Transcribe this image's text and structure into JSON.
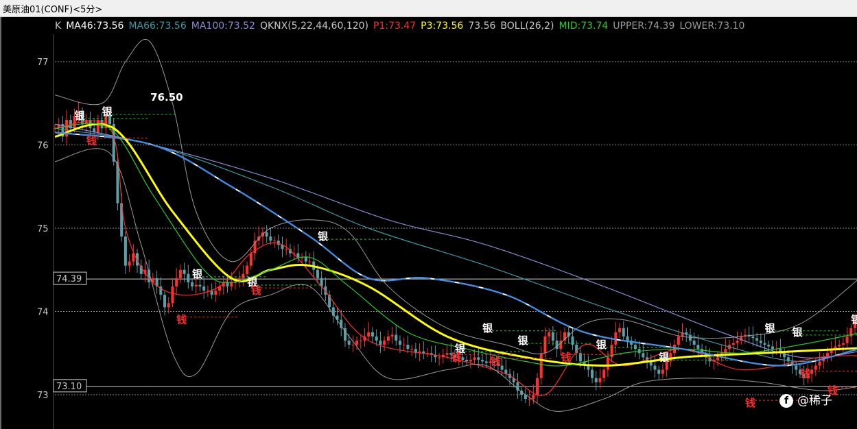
{
  "window": {
    "title": "美原油01(CONF)<5分>"
  },
  "legend": [
    {
      "text": "K",
      "color": "#c8c8c8"
    },
    {
      "text": "MA46:73.56",
      "color": "#ffffff"
    },
    {
      "text": "MA66:73.56",
      "color": "#3a9aa0"
    },
    {
      "text": "MA100:73.52",
      "color": "#8a8ad8"
    },
    {
      "text": "QKNX(5,22,44,60,120)",
      "color": "#c8c8c8"
    },
    {
      "text": "P1:73.47",
      "color": "#ff2a2a"
    },
    {
      "text": "P3:73.56",
      "color": "#ffff00"
    },
    {
      "text": "73.56",
      "color": "#c8c8c8"
    },
    {
      "text": "BOLL(26,2)",
      "color": "#c8c8c8"
    },
    {
      "text": "MID:73.74",
      "color": "#22cc22"
    },
    {
      "text": "UPPER:74.39",
      "color": "#9a9a9a"
    },
    {
      "text": "LOWER:73.10",
      "color": "#9a9a9a"
    }
  ],
  "watermark": {
    "text": "@稀子",
    "icon": "facebook-icon"
  },
  "chart_data": {
    "type": "line",
    "instrument": "美原油01(CONF)",
    "interval": "5分",
    "ylim": [
      72.6,
      77.4
    ],
    "y_ticks": [
      "77",
      "76",
      "75",
      "74",
      "73"
    ],
    "grid": true,
    "hlines": [
      {
        "label": "74.39",
        "value": 74.39
      },
      {
        "label": "73.10",
        "value": 73.1
      }
    ],
    "peak_label": {
      "text": "76.50",
      "x": 24,
      "y": 76.5
    },
    "x_count": 205,
    "price_close": [
      76.2,
      76.25,
      76.1,
      76.3,
      76.2,
      76.35,
      76.4,
      76.25,
      76.3,
      76.2,
      76.15,
      76.3,
      76.2,
      76.35,
      76.25,
      75.8,
      75.3,
      74.9,
      74.55,
      74.6,
      74.7,
      74.55,
      74.45,
      74.5,
      74.35,
      74.4,
      74.3,
      74.2,
      74.05,
      74.1,
      74.3,
      74.4,
      74.5,
      74.45,
      74.35,
      74.3,
      74.32,
      74.3,
      74.25,
      74.25,
      74.2,
      74.25,
      74.3,
      74.35,
      74.3,
      74.35,
      74.35,
      74.4,
      74.45,
      74.55,
      74.7,
      74.85,
      74.9,
      74.95,
      74.9,
      74.85,
      74.85,
      74.8,
      74.75,
      74.75,
      74.7,
      74.7,
      74.65,
      74.65,
      74.6,
      74.6,
      74.5,
      74.4,
      74.3,
      74.2,
      74.05,
      73.95,
      73.9,
      73.8,
      73.65,
      73.6,
      73.6,
      73.65,
      73.65,
      73.7,
      73.75,
      73.7,
      73.65,
      73.6,
      73.65,
      73.7,
      73.72,
      73.65,
      73.6,
      73.6,
      73.55,
      73.55,
      73.5,
      73.52,
      73.5,
      73.5,
      73.48,
      73.45,
      73.45,
      73.48,
      73.5,
      73.48,
      73.45,
      73.45,
      73.42,
      73.4,
      73.42,
      73.45,
      73.42,
      73.4,
      73.38,
      73.4,
      73.38,
      73.35,
      73.3,
      73.25,
      73.2,
      73.15,
      73.05,
      73.0,
      72.95,
      72.95,
      73.0,
      73.2,
      73.5,
      73.7,
      73.75,
      73.65,
      73.55,
      73.65,
      73.75,
      73.7,
      73.6,
      73.5,
      73.4,
      73.35,
      73.3,
      73.2,
      73.15,
      73.2,
      73.3,
      73.45,
      73.6,
      73.75,
      73.8,
      73.7,
      73.65,
      73.6,
      73.55,
      73.5,
      73.45,
      73.4,
      73.35,
      73.3,
      73.25,
      73.3,
      73.4,
      73.5,
      73.6,
      73.7,
      73.75,
      73.72,
      73.65,
      73.6,
      73.55,
      73.5,
      73.45,
      73.4,
      73.42,
      73.45,
      73.5,
      73.55,
      73.6,
      73.62,
      73.65,
      73.7,
      73.72,
      73.7,
      73.68,
      73.65,
      73.62,
      73.6,
      73.58,
      73.55,
      73.55,
      73.5,
      73.45,
      73.4,
      73.35,
      73.3,
      73.25,
      73.2,
      73.25,
      73.3,
      73.35,
      73.4,
      73.45,
      73.5,
      73.55,
      73.58,
      73.6,
      73.62,
      73.7,
      73.8,
      73.9
    ],
    "series": [
      {
        "name": "MA46",
        "color": "#ffffff",
        "points": [
          [
            0,
            76.15
          ],
          [
            25,
            76.0
          ],
          [
            45,
            75.5
          ],
          [
            65,
            74.9
          ],
          [
            80,
            74.4
          ],
          [
            95,
            74.4
          ],
          [
            115,
            74.2
          ],
          [
            135,
            73.75
          ],
          [
            160,
            73.55
          ],
          [
            185,
            73.35
          ],
          [
            205,
            73.55
          ]
        ]
      },
      {
        "name": "MA66",
        "color": "#3a9aa0",
        "points": [
          [
            0,
            76.2
          ],
          [
            25,
            76.0
          ],
          [
            55,
            75.5
          ],
          [
            80,
            75.0
          ],
          [
            110,
            74.55
          ],
          [
            140,
            74.05
          ],
          [
            170,
            73.6
          ],
          [
            190,
            73.4
          ],
          [
            205,
            73.55
          ]
        ]
      },
      {
        "name": "MA100",
        "color": "#8a8ad8",
        "points": [
          [
            0,
            76.25
          ],
          [
            25,
            76.0
          ],
          [
            55,
            75.6
          ],
          [
            85,
            75.1
          ],
          [
            110,
            74.8
          ],
          [
            140,
            74.3
          ],
          [
            170,
            73.75
          ],
          [
            190,
            73.45
          ],
          [
            205,
            73.52
          ]
        ]
      },
      {
        "name": "P1",
        "color": "#ff2a2a",
        "points": [
          [
            0,
            76.2
          ],
          [
            14,
            76.2
          ],
          [
            18,
            75.0
          ],
          [
            24,
            74.4
          ],
          [
            32,
            74.2
          ],
          [
            42,
            74.3
          ],
          [
            50,
            74.7
          ],
          [
            58,
            74.8
          ],
          [
            68,
            74.3
          ],
          [
            80,
            73.65
          ],
          [
            100,
            73.45
          ],
          [
            115,
            73.25
          ],
          [
            125,
            73.0
          ],
          [
            135,
            73.6
          ],
          [
            145,
            73.35
          ],
          [
            160,
            73.55
          ],
          [
            175,
            73.3
          ],
          [
            195,
            73.45
          ],
          [
            205,
            73.47
          ]
        ]
      },
      {
        "name": "P3",
        "color": "#ffff00",
        "points": [
          [
            0,
            76.1
          ],
          [
            15,
            76.2
          ],
          [
            30,
            75.2
          ],
          [
            45,
            74.4
          ],
          [
            55,
            74.5
          ],
          [
            65,
            74.55
          ],
          [
            80,
            74.3
          ],
          [
            100,
            73.7
          ],
          [
            120,
            73.45
          ],
          [
            140,
            73.35
          ],
          [
            160,
            73.45
          ],
          [
            180,
            73.5
          ],
          [
            205,
            73.56
          ]
        ]
      },
      {
        "name": "MID",
        "color": "#22cc22",
        "points": [
          [
            0,
            76.2
          ],
          [
            14,
            76.2
          ],
          [
            25,
            75.4
          ],
          [
            38,
            74.5
          ],
          [
            45,
            74.35
          ],
          [
            55,
            74.5
          ],
          [
            65,
            74.65
          ],
          [
            75,
            74.3
          ],
          [
            90,
            73.75
          ],
          [
            105,
            73.55
          ],
          [
            120,
            73.4
          ],
          [
            130,
            73.35
          ],
          [
            145,
            73.5
          ],
          [
            160,
            73.55
          ],
          [
            175,
            73.5
          ],
          [
            190,
            73.6
          ],
          [
            205,
            73.74
          ]
        ]
      },
      {
        "name": "UPPER",
        "color": "#9a9a9a",
        "points": [
          [
            0,
            76.6
          ],
          [
            12,
            76.5
          ],
          [
            18,
            77.0
          ],
          [
            24,
            77.25
          ],
          [
            30,
            76.5
          ],
          [
            36,
            75.2
          ],
          [
            45,
            74.6
          ],
          [
            55,
            75.0
          ],
          [
            66,
            75.1
          ],
          [
            75,
            74.95
          ],
          [
            85,
            74.3
          ],
          [
            100,
            73.8
          ],
          [
            115,
            73.6
          ],
          [
            125,
            73.5
          ],
          [
            135,
            73.85
          ],
          [
            145,
            73.9
          ],
          [
            160,
            73.7
          ],
          [
            175,
            73.7
          ],
          [
            190,
            73.85
          ],
          [
            205,
            74.39
          ]
        ]
      },
      {
        "name": "LOWER",
        "color": "#9a9a9a",
        "points": [
          [
            0,
            75.8
          ],
          [
            14,
            75.9
          ],
          [
            22,
            74.8
          ],
          [
            30,
            73.5
          ],
          [
            36,
            73.25
          ],
          [
            45,
            74.0
          ],
          [
            55,
            74.2
          ],
          [
            65,
            74.3
          ],
          [
            75,
            73.7
          ],
          [
            85,
            73.2
          ],
          [
            100,
            73.3
          ],
          [
            110,
            73.35
          ],
          [
            120,
            73.0
          ],
          [
            128,
            72.8
          ],
          [
            140,
            72.95
          ],
          [
            150,
            73.15
          ],
          [
            165,
            73.2
          ],
          [
            180,
            73.15
          ],
          [
            195,
            73.05
          ],
          [
            205,
            73.1
          ]
        ]
      }
    ],
    "markers": [
      {
        "text": "银",
        "color": "#ffffff",
        "x": 5,
        "y": 76.35
      },
      {
        "text": "银",
        "color": "#ffffff",
        "x": 12,
        "y": 76.4
      },
      {
        "text": "钱",
        "color": "#ff2a2a",
        "x": 8,
        "y": 76.05
      },
      {
        "text": "银",
        "color": "#ffffff",
        "x": 35,
        "y": 74.45
      },
      {
        "text": "钱",
        "color": "#ff2a2a",
        "x": 31,
        "y": 73.9
      },
      {
        "text": "银",
        "color": "#ffffff",
        "x": 49,
        "y": 74.35
      },
      {
        "text": "钱",
        "color": "#ff2a2a",
        "x": 50,
        "y": 74.25
      },
      {
        "text": "银",
        "color": "#ffffff",
        "x": 67,
        "y": 74.9
      },
      {
        "text": "银",
        "color": "#ffffff",
        "x": 102,
        "y": 73.55
      },
      {
        "text": "钱",
        "color": "#ff2a2a",
        "x": 101,
        "y": 73.45
      },
      {
        "text": "银",
        "color": "#ffffff",
        "x": 109,
        "y": 73.8
      },
      {
        "text": "钱",
        "color": "#ff2a2a",
        "x": 111,
        "y": 73.4
      },
      {
        "text": "银",
        "color": "#ffffff",
        "x": 118,
        "y": 73.65
      },
      {
        "text": "钱",
        "color": "#ff2a2a",
        "x": 129,
        "y": 73.45
      },
      {
        "text": "银",
        "color": "#ffffff",
        "x": 138,
        "y": 73.6
      },
      {
        "text": "银",
        "color": "#ffffff",
        "x": 154,
        "y": 73.45
      },
      {
        "text": "银",
        "color": "#ffffff",
        "x": 181,
        "y": 73.8
      },
      {
        "text": "钱",
        "color": "#ff2a2a",
        "x": 176,
        "y": 72.9
      },
      {
        "text": "银",
        "color": "#ffffff",
        "x": 188,
        "y": 73.75
      },
      {
        "text": "钱",
        "color": "#ff2a2a",
        "x": 190,
        "y": 73.25
      },
      {
        "text": "钱",
        "color": "#ff2a2a",
        "x": 197,
        "y": 73.05
      },
      {
        "text": "银",
        "color": "#ffffff",
        "x": 203,
        "y": 73.9
      }
    ]
  }
}
